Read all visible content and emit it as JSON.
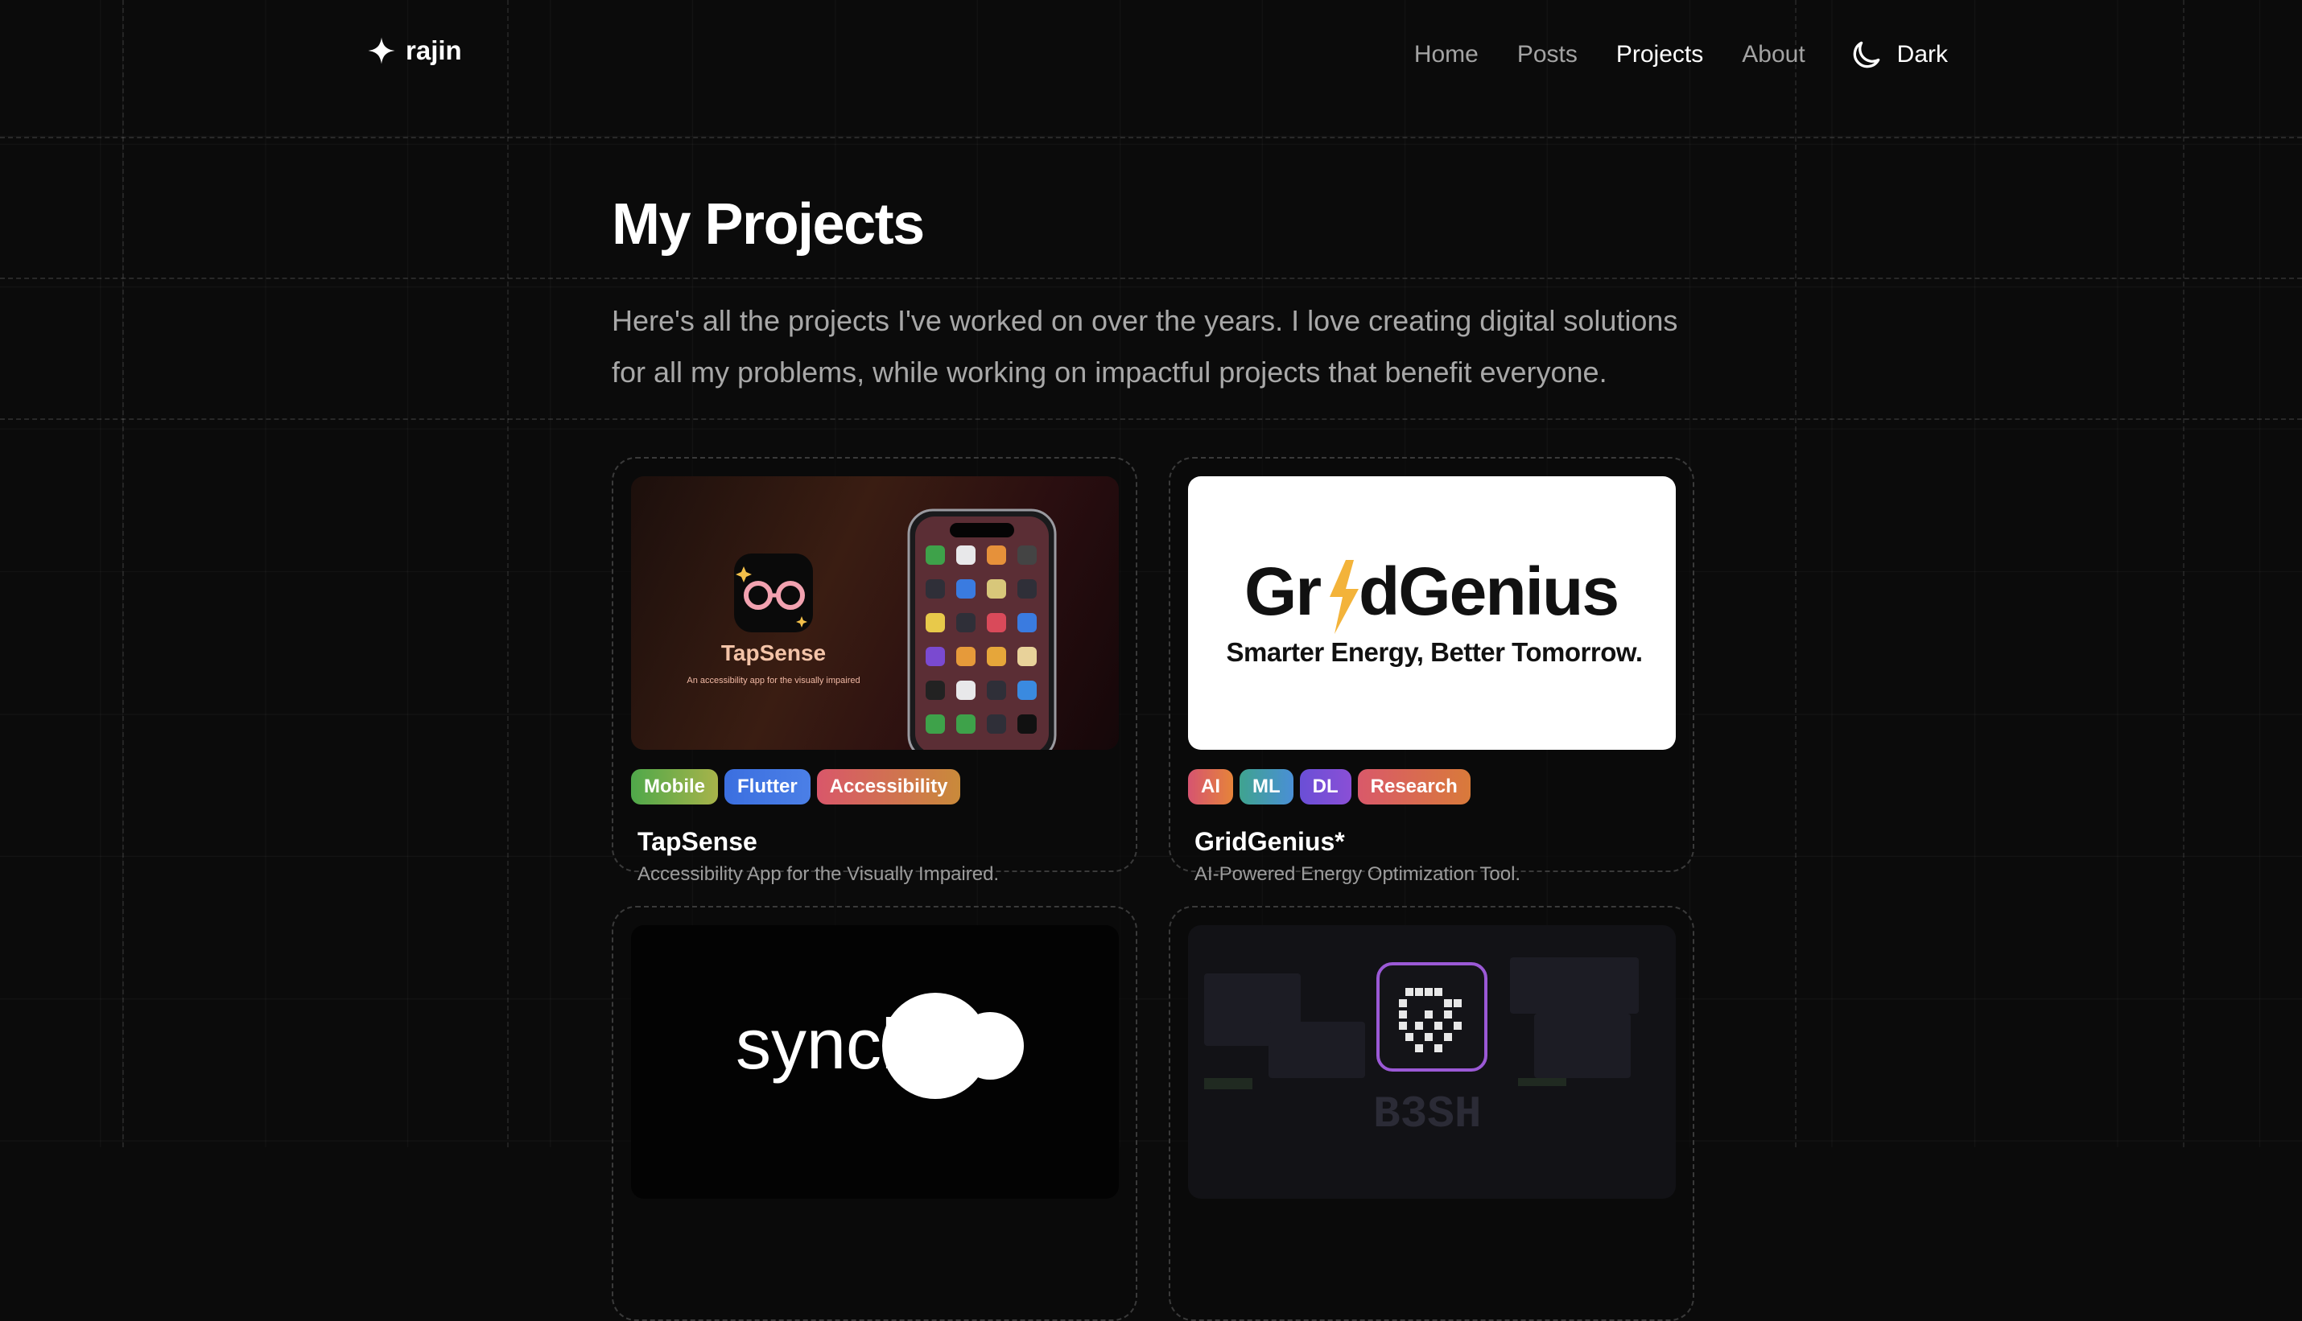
{
  "header": {
    "logo_text": "rajin",
    "nav": [
      {
        "label": "Home"
      },
      {
        "label": "Posts"
      },
      {
        "label": "Projects"
      },
      {
        "label": "About"
      }
    ],
    "theme_label": "Dark"
  },
  "page": {
    "title": "My Projects",
    "intro": "Here's all the projects I've worked on over the years. I love creating digital solutions for all my problems, while working on impactful projects that benefit everyone."
  },
  "projects": [
    {
      "title": "TapSense",
      "description": "Accessibility App for the Visually Impaired.",
      "thumb_title": "TapSense",
      "thumb_subtitle": "An accessibility app for the visually impaired",
      "tags": [
        {
          "label": "Mobile",
          "color": "#4fa84a"
        },
        {
          "label": "Flutter",
          "color": "#3b6fe0"
        },
        {
          "label": "Accessibility",
          "color": "#d9576a"
        }
      ]
    },
    {
      "title": "GridGenius*",
      "description": "AI-Powered Energy Optimization Tool.",
      "thumb_title_a": "Gr",
      "thumb_title_b": "dGenius",
      "thumb_subtitle": "Smarter Energy, Better Tomorrow.",
      "tags": [
        {
          "label": "AI",
          "color": "#d65470"
        },
        {
          "label": "ML",
          "color": "#3fa38f"
        },
        {
          "label": "DL",
          "color": "#6a4fd6"
        },
        {
          "label": "Research",
          "color": "#d9596a"
        }
      ]
    },
    {
      "thumb_text": "syncly"
    },
    {
      "thumb_text": "B3SH"
    }
  ],
  "colors": {
    "background": "#0b0b0b",
    "accent_amber": "#f3b33a",
    "thumb_purple": "#9b59d6"
  }
}
